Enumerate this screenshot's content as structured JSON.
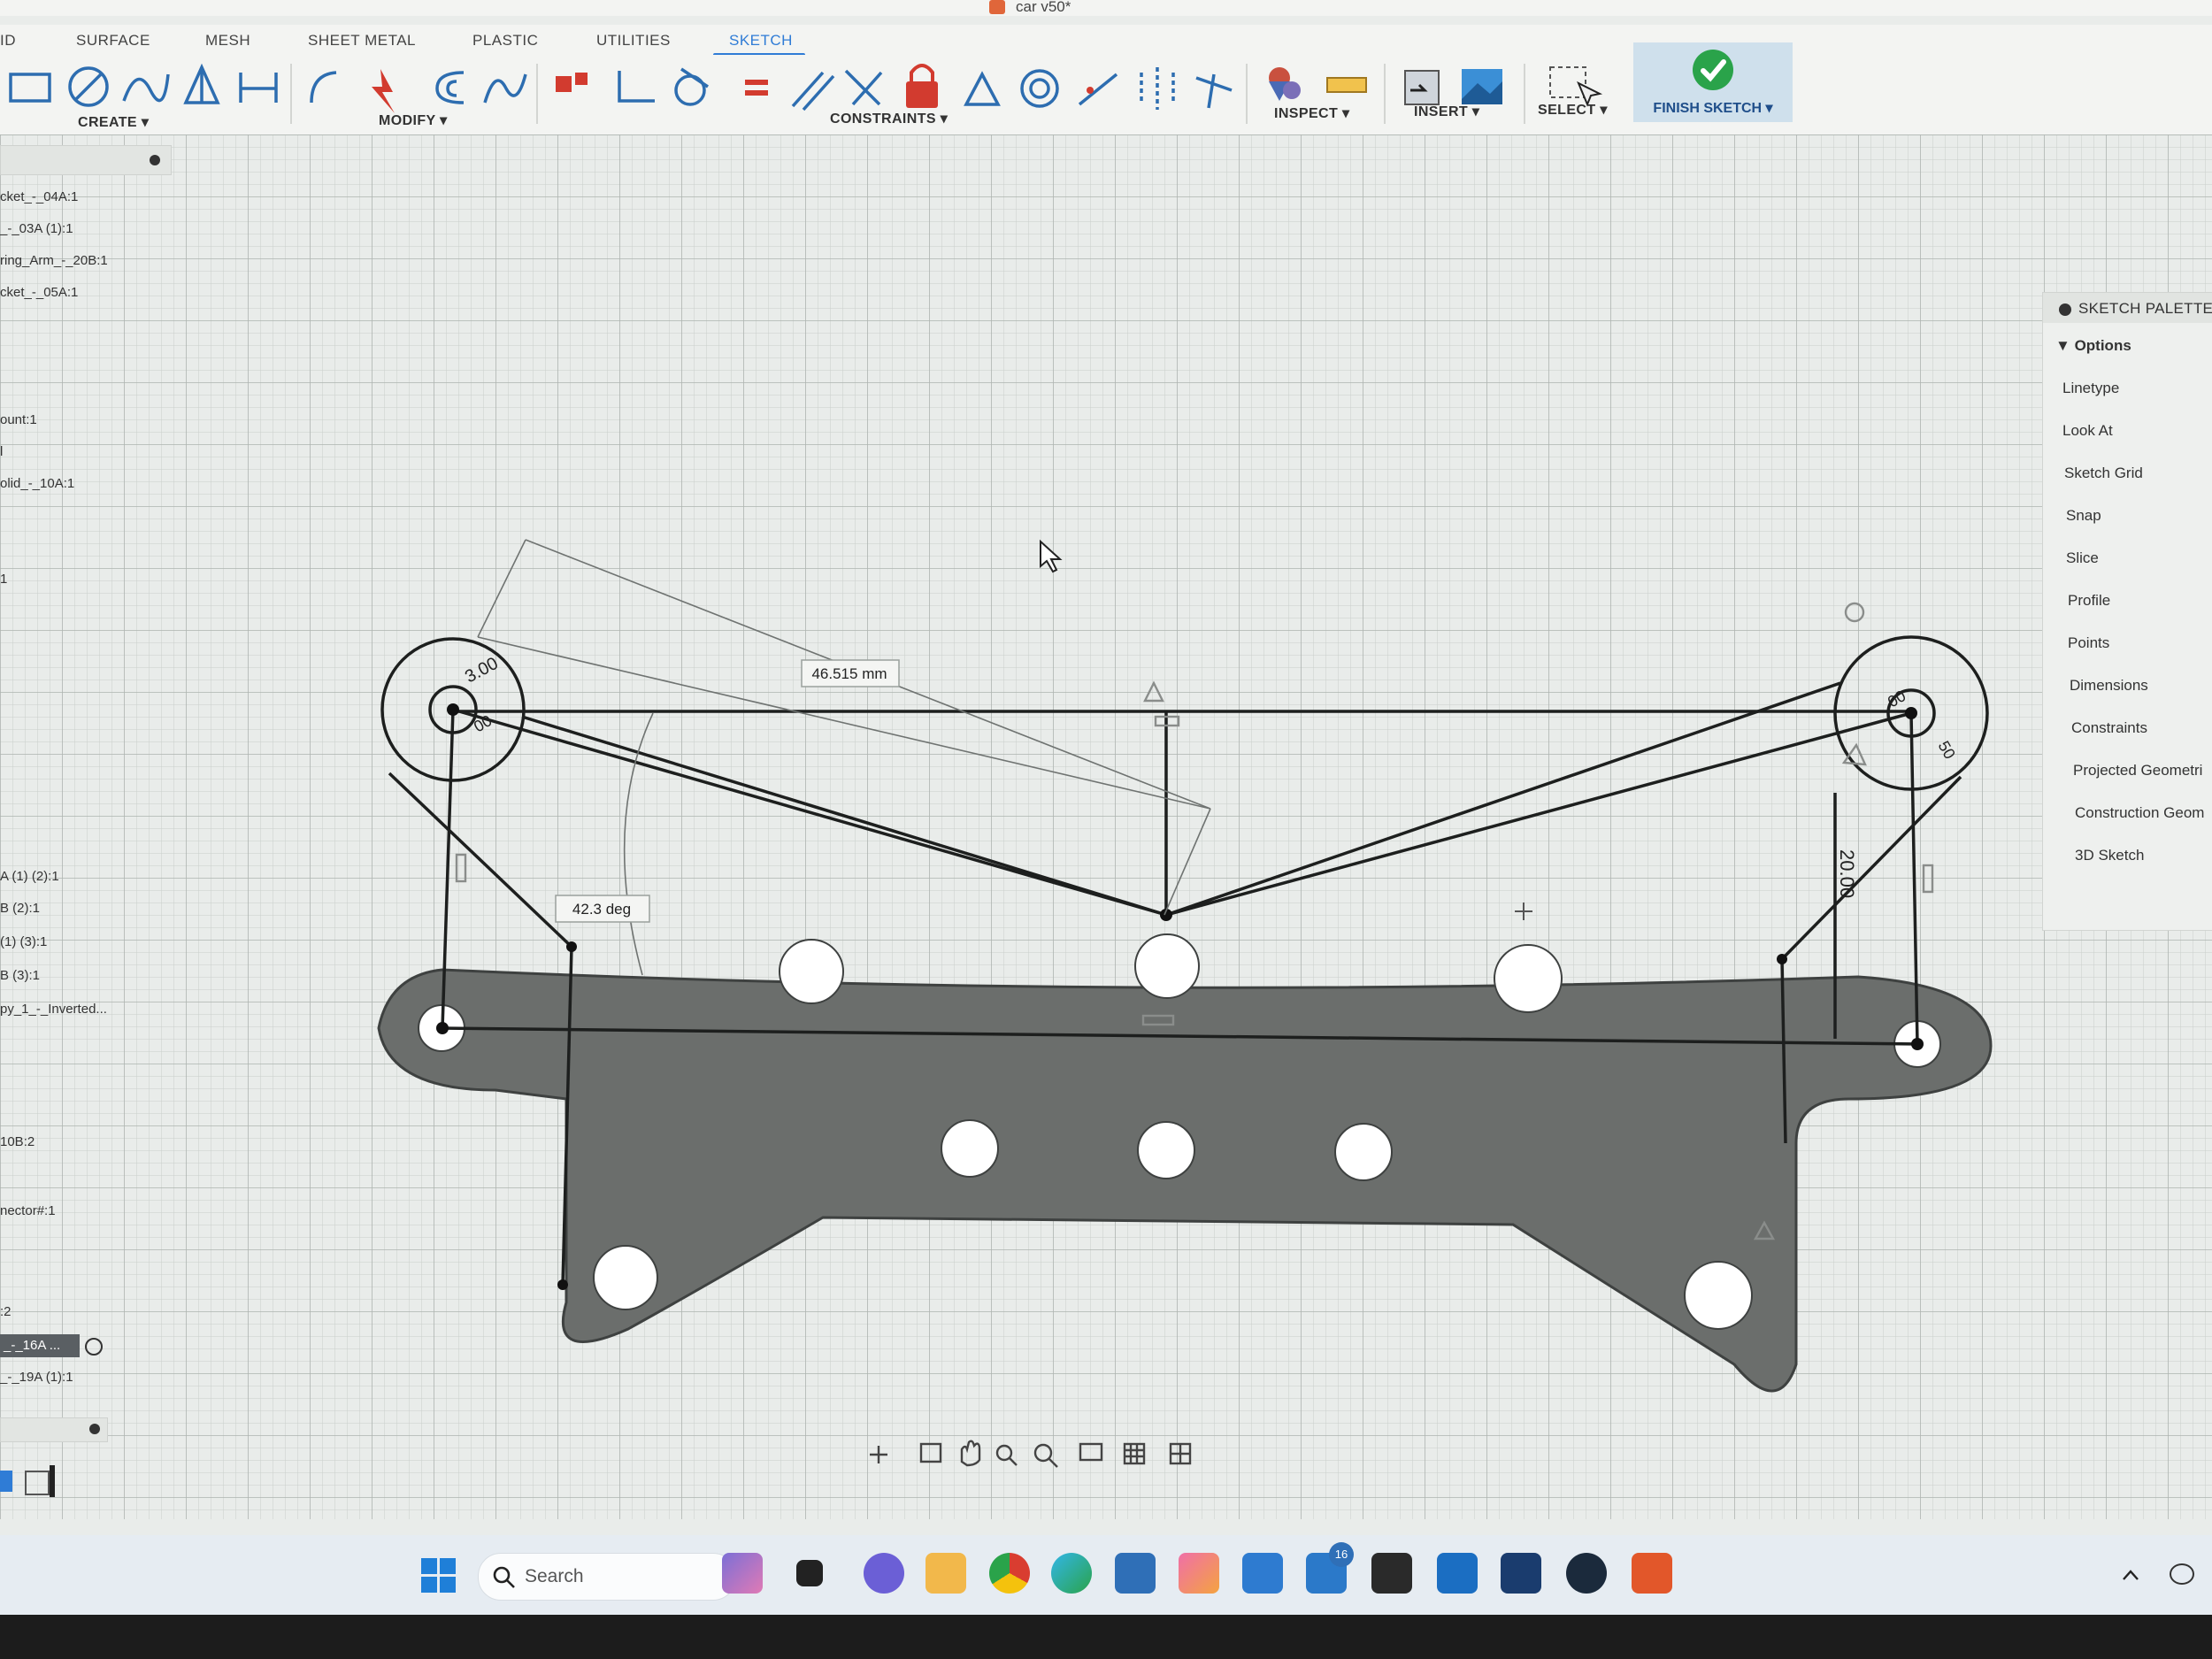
{
  "window": {
    "title": "car v50*"
  },
  "tabs": [
    {
      "label": "ID"
    },
    {
      "label": "SURFACE"
    },
    {
      "label": "MESH"
    },
    {
      "label": "SHEET METAL"
    },
    {
      "label": "PLASTIC"
    },
    {
      "label": "UTILITIES"
    },
    {
      "label": "SKETCH"
    }
  ],
  "ribbon": {
    "create": "CREATE ▾",
    "modify": "MODIFY ▾",
    "constraints": "CONSTRAINTS ▾",
    "inspect": "INSPECT ▾",
    "insert": "INSERT ▾",
    "select": "SELECT ▾",
    "finish": "FINISH SKETCH ▾"
  },
  "browser": {
    "items": [
      "cket_-_04A:1",
      "_-_03A (1):1",
      "ring_Arm_-_20B:1",
      "cket_-_05A:1",
      "ount:1",
      "l",
      "olid_-_10A:1",
      "1",
      "A (1) (2):1",
      "B (2):1",
      "(1) (3):1",
      "B (3):1",
      "py_1_-_Inverted...",
      "10B:2",
      "nector#:1",
      ":2",
      "_-_16A ...",
      "_-_19A (1):1"
    ]
  },
  "sketch": {
    "dim_length": "46.515 mm",
    "dim_angle": "42.3 deg",
    "dim_radius_left": "3.00",
    "dim_vertical": "20.00",
    "dim_left_small": "00",
    "dim_right_small": "00",
    "dim_right_small2": "50"
  },
  "palette": {
    "title": "SKETCH PALETTE",
    "section": "Options",
    "items": [
      "Linetype",
      "Look At",
      "Sketch Grid",
      "Snap",
      "Slice",
      "Profile",
      "Points",
      "Dimensions",
      "Constraints",
      "Projected Geometri",
      "Construction Geom",
      "3D Sketch"
    ]
  },
  "taskbar": {
    "search_label": "Search",
    "badge": "16"
  }
}
